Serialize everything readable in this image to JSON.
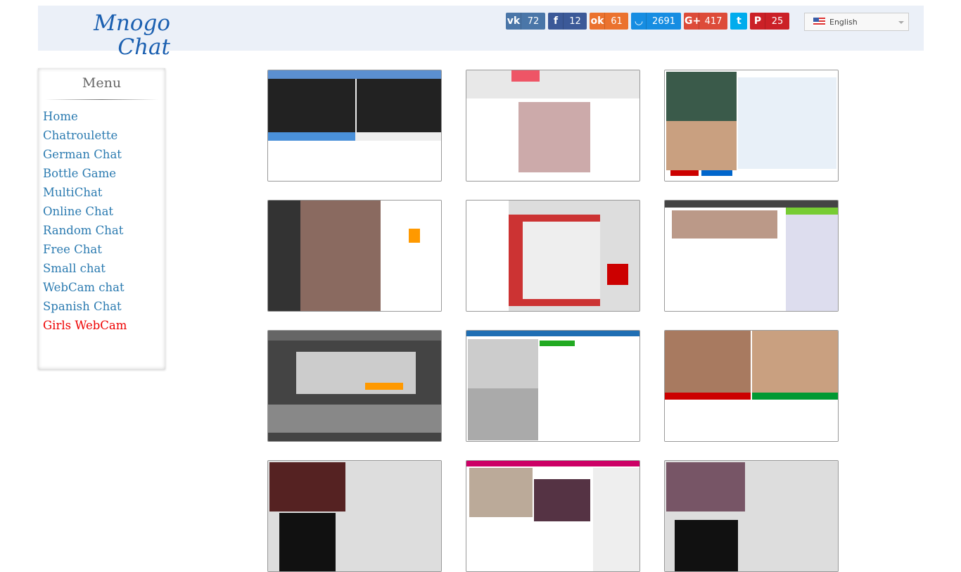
{
  "site": {
    "logo": "Mnogo Chat"
  },
  "share": [
    {
      "icon": "vk-icon",
      "glyph": "vk",
      "count": "72",
      "color": "#4a76a8"
    },
    {
      "icon": "facebook-icon",
      "glyph": "f",
      "count": "12",
      "color": "#3b5998"
    },
    {
      "icon": "odnoklassniki-icon",
      "glyph": "ok",
      "count": "61",
      "color": "#eb722e"
    },
    {
      "icon": "moimir-icon",
      "glyph": "◡",
      "count": "2691",
      "color": "#168de2"
    },
    {
      "icon": "googleplus-icon",
      "glyph": "G+",
      "count": "417",
      "color": "#dd4b39"
    },
    {
      "icon": "twitter-icon",
      "glyph": "t",
      "count": "",
      "color": "#00aced"
    },
    {
      "icon": "pinterest-icon",
      "glyph": "P",
      "count": "25",
      "color": "#cb2027"
    }
  ],
  "language": {
    "selected": "English"
  },
  "menu": {
    "title": "Menu",
    "items": [
      "Home",
      "Chatroulette",
      "German Chat",
      "Bottle Game",
      "MultiChat",
      "Online Chat",
      "Random Chat",
      "Free Chat",
      "Small chat",
      "WebCam chat",
      "Spanish Chat",
      "Girls WebCam"
    ],
    "active_index": 11
  },
  "thumbnails": [
    "chat-screenshot-1",
    "chat-screenshot-2",
    "chat-screenshot-3",
    "chat-screenshot-4",
    "spin-the-bottle-screenshot",
    "chat-screenshot-6",
    "chat-screenshot-7",
    "video-chat-screenshot",
    "chat-screenshot-9",
    "chat-screenshot-10",
    "chat-screenshot-11",
    "chat-screenshot-12"
  ]
}
